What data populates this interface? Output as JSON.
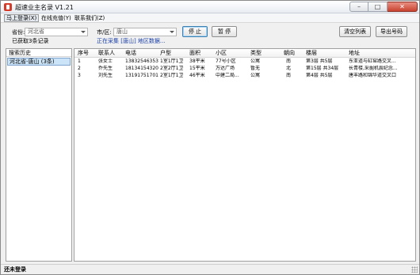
{
  "window": {
    "title": "超速业主名录 V1.21",
    "minimize_icon": "minimize-icon",
    "maximize_icon": "maximize-icon",
    "close_icon": "close-icon"
  },
  "menu": [
    "马上登录(X)",
    "在线充值(Y)",
    "联系我们(Z)"
  ],
  "controls": {
    "province_label": "省份:",
    "province_value": "河北省",
    "city_label": "市/区:",
    "city_value": "唐山",
    "stop_button": "停 止",
    "pause_button": "暂 停",
    "clear_button": "清空列表",
    "export_button": "导出号码"
  },
  "status": {
    "fetched_text": "已获取3条记录",
    "collecting_text": "正在采集 [唐山] 地区数据..."
  },
  "history": {
    "header": "搜索历史",
    "items": [
      "河北省-唐山 (3条)"
    ]
  },
  "table": {
    "columns": [
      "序号",
      "联系人",
      "电话",
      "户型",
      "面积",
      "小区",
      "类型",
      "朝向",
      "楼层",
      "地址"
    ],
    "rows": [
      [
        "1",
        "张女士",
        "13832546353",
        "1室1厅1卫",
        "38平米",
        "77号小区",
        "公寓",
        "南",
        "第3层 共5层",
        "东亚道与缸窑路交叉..."
      ],
      [
        "2",
        "乔先生",
        "18134154320",
        "2室2厅1卫",
        "15平米",
        "万达广场",
        "暂无",
        "北",
        "第15层 共34层",
        "长青楼,采掘机震纪念..."
      ],
      [
        "3",
        "刘先生",
        "13191751701",
        "2室1厅1卫",
        "46平米",
        "中建二局...",
        "公寓",
        "南",
        "第4层 共5层",
        "唐丰路和锦华道交叉口"
      ]
    ]
  },
  "statusbar": {
    "text": "还未登录"
  },
  "colors": {
    "accent_blue": "#1a3fa8",
    "selection": "#cce4f7",
    "close_red": "#c9432f"
  }
}
